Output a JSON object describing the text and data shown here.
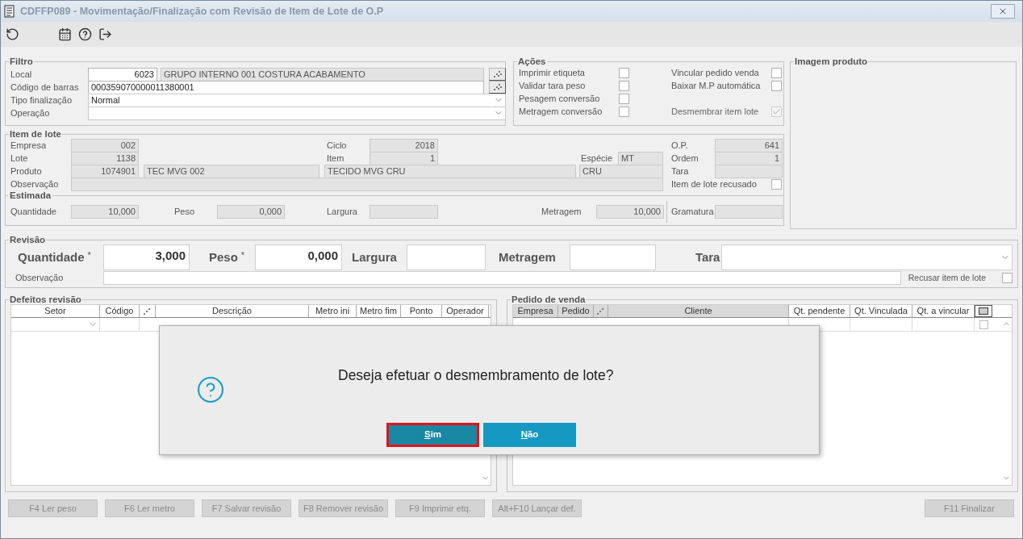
{
  "window": {
    "title": "CDFFP089 - Movimentação/Finalização com Revisão de Item de Lote de O.P"
  },
  "filtro": {
    "legend": "Filtro",
    "local": {
      "label": "Local",
      "code": "6023",
      "description": "GRUPO INTERNO 001 COSTURA ACABAMENTO"
    },
    "barcode": {
      "label": "Código de barras",
      "value": "000359070000011380001"
    },
    "tipo": {
      "label": "Tipo finalização",
      "value": "Normal"
    },
    "operacao": {
      "label": "Operação"
    }
  },
  "acoes": {
    "legend": "Ações",
    "rows": [
      {
        "left": {
          "label": "Imprimir etiqueta",
          "checked": false,
          "disabled": false
        },
        "right": {
          "label": "Vincular pedido venda",
          "checked": false,
          "disabled": false
        }
      },
      {
        "left": {
          "label": "Validar tara peso",
          "checked": false,
          "disabled": false
        },
        "right": {
          "label": "Baixar M.P automática",
          "checked": false,
          "disabled": false
        }
      },
      {
        "left": {
          "label": "Pesagem conversão",
          "checked": false,
          "disabled": false
        }
      },
      {
        "left": {
          "label": "Metragem conversão",
          "checked": false,
          "disabled": false
        },
        "right": {
          "label": "Desmembrar item lote",
          "checked": true,
          "disabled": true
        }
      }
    ]
  },
  "imagem": {
    "legend": "Imagem produto"
  },
  "item": {
    "legend": "Item de lote",
    "empresa": {
      "label": "Empresa",
      "value": "002"
    },
    "ciclo": {
      "label": "Ciclo",
      "value": "2018"
    },
    "op": {
      "label": "O.P.",
      "value": "641"
    },
    "lote": {
      "label": "Lote",
      "value": "1138"
    },
    "item": {
      "label": "Item",
      "value": "1"
    },
    "especie": {
      "label": "Espécie",
      "value": "MT"
    },
    "ordem": {
      "label": "Ordem",
      "value": "1"
    },
    "produto": {
      "label": "Produto",
      "code": "1074901",
      "name": "TEC MVG 002",
      "description": "TECIDO MVG CRU",
      "type": "CRU"
    },
    "tara": {
      "label": "Tara"
    },
    "observacao": {
      "label": "Observação"
    },
    "recusado": {
      "label": "Item de lote recusado",
      "checked": false
    },
    "estimada": {
      "legend": "Estimada",
      "quantidade": {
        "label": "Quantidade",
        "value": "10,000"
      },
      "peso": {
        "label": "Peso",
        "value": "0,000"
      },
      "largura": {
        "label": "Largura"
      },
      "metragem": {
        "label": "Metragem",
        "value": "10,000"
      },
      "gramatura": {
        "label": "Gramatura"
      }
    }
  },
  "revisao": {
    "legend": "Revisão",
    "quantidade": {
      "label": "Quantidade",
      "mark": "*",
      "value": "3,000"
    },
    "peso": {
      "label": "Peso",
      "mark": "*",
      "value": "0,000"
    },
    "largura": {
      "label": "Largura"
    },
    "metragem": {
      "label": "Metragem"
    },
    "tara": {
      "label": "Tara"
    },
    "observacao": {
      "label": "Observação"
    },
    "recusar": {
      "label": "Recusar item de lote",
      "checked": false
    }
  },
  "defeitos": {
    "legend": "Defeitos revisão",
    "columns": [
      {
        "kind": "text",
        "label": "Setor"
      },
      {
        "kind": "text",
        "label": "Código"
      },
      {
        "kind": "icon"
      },
      {
        "kind": "text",
        "label": "Descrição"
      },
      {
        "kind": "text",
        "label": "Metro ini"
      },
      {
        "kind": "text",
        "label": "Metro fim"
      },
      {
        "kind": "text",
        "label": "Ponto"
      },
      {
        "kind": "text",
        "label": "Operador"
      }
    ]
  },
  "pedido": {
    "legend": "Pedido de venda",
    "columns": [
      {
        "kind": "text",
        "label": "Empresa",
        "shaded": true
      },
      {
        "kind": "text",
        "label": "Pedido",
        "shaded": true
      },
      {
        "kind": "icon",
        "shaded": true
      },
      {
        "kind": "text",
        "label": "Cliente",
        "shaded": true
      },
      {
        "kind": "text",
        "label": "Qt. pendente",
        "shaded": false
      },
      {
        "kind": "text",
        "label": "Qt. Vinculada",
        "shaded": false
      },
      {
        "kind": "text",
        "label": "Qt. a vincular",
        "shaded": false
      },
      {
        "kind": "button",
        "shaded": false
      }
    ],
    "row": {
      "checked": false
    }
  },
  "footer": {
    "left": [
      {
        "label": "F4 Ler peso",
        "disabled": true
      },
      {
        "label": "F6 Ler metro",
        "disabled": true
      },
      {
        "label": "F7 Salvar revisão",
        "disabled": true
      },
      {
        "label": "F8 Remover revisão",
        "disabled": true
      },
      {
        "label": "F9 Imprimir etq.",
        "disabled": true
      },
      {
        "label": "Alt+F10 Lançar def.",
        "disabled": true
      }
    ],
    "right": [
      {
        "label": "F11 Finalizar",
        "disabled": true
      }
    ]
  },
  "dialog": {
    "message": "Deseja efetuar o desmembramento de lote?",
    "buttons": [
      {
        "label": "Sim",
        "selected": true
      },
      {
        "label": "Não",
        "selected": false
      }
    ]
  }
}
